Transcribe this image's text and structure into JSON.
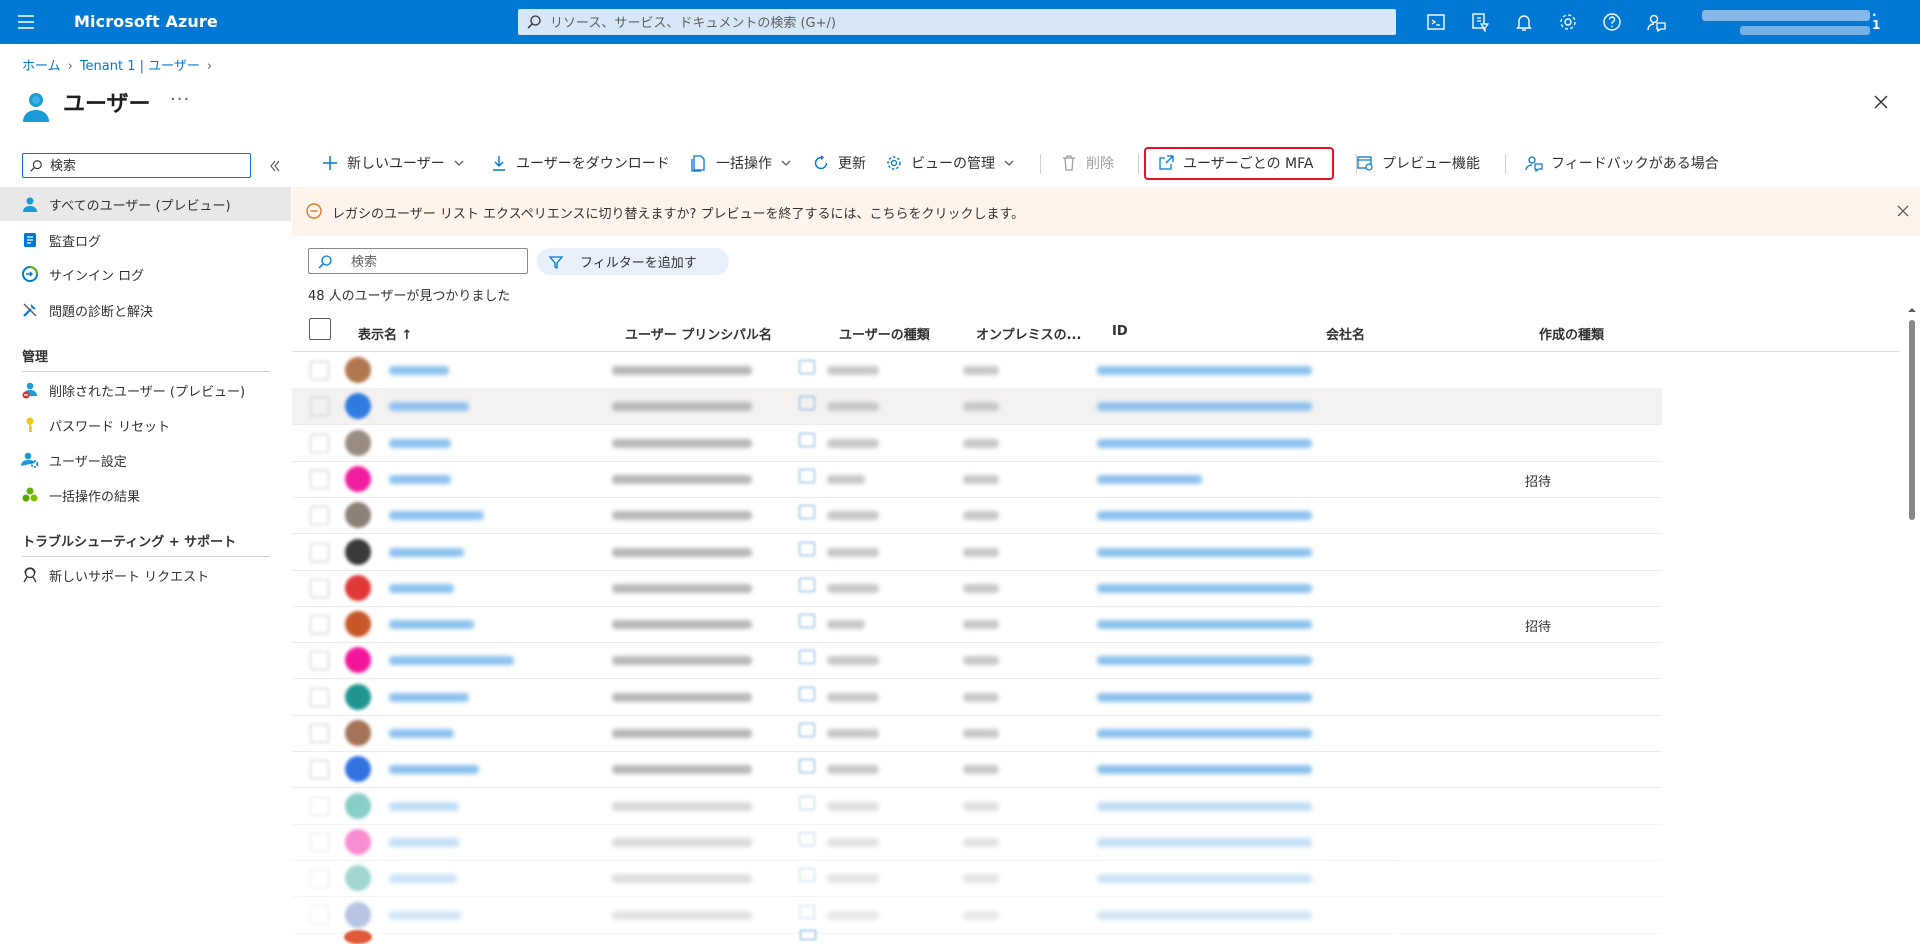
{
  "topbar": {
    "brand": "Microsoft Azure",
    "search_placeholder": "リソース、サービス、ドキュメントの検索 (G+/)",
    "account_badge": "1",
    "icons": [
      "cloud-shell-icon",
      "directory-filter-icon",
      "notifications-icon",
      "settings-icon",
      "help-icon",
      "feedback-icon"
    ],
    "bar_color": "#0078d4"
  },
  "breadcrumb": [
    "ホーム",
    "Tenant 1 | ユーザー"
  ],
  "page": {
    "title": "ユーザー",
    "more": "···"
  },
  "nav": {
    "search_placeholder": "検索",
    "items": [
      {
        "label": "すべてのユーザー (プレビュー)",
        "icon": "user-icon",
        "active": true
      },
      {
        "label": "監査ログ",
        "icon": "audit-log-icon"
      },
      {
        "label": "サインイン ログ",
        "icon": "signin-log-icon"
      },
      {
        "label": "問題の診断と解決",
        "icon": "wrench-icon"
      }
    ],
    "section_manage": "管理",
    "manage_items": [
      {
        "label": "削除されたユーザー (プレビュー)",
        "icon": "deleted-user-icon"
      },
      {
        "label": "パスワード リセット",
        "icon": "key-icon"
      },
      {
        "label": "ユーザー設定",
        "icon": "user-settings-icon"
      },
      {
        "label": "一括操作の結果",
        "icon": "bulk-results-icon"
      }
    ],
    "section_support": "トラブルシューティング + サポート",
    "support_items": [
      {
        "label": "新しいサポート リクエスト",
        "icon": "support-request-icon"
      }
    ]
  },
  "commands": {
    "new_user": "新しいユーザー",
    "download": "ユーザーをダウンロード",
    "bulk": "一括操作",
    "refresh": "更新",
    "manage_view": "ビューの管理",
    "delete": "削除",
    "per_user_mfa": "ユーザーごとの MFA",
    "preview_features": "プレビュー機能",
    "feedback": "フィードバックがある場合"
  },
  "banner": {
    "text": "レガシのユーザー リスト エクスペリエンスに切り替えますか? プレビューを終了するには、こちらをクリックします。"
  },
  "filter": {
    "search_placeholder": "検索",
    "add_filter": "フィルターを追加す",
    "result_count": "48 人のユーザーが見つかりました"
  },
  "table": {
    "columns": [
      "表示名 ↑",
      "ユーザー プリンシパル名",
      "ユーザーの種類",
      "オンプレミスの...",
      "ID",
      "会社名",
      "作成の種類"
    ],
    "rows": [
      {
        "creation_type": ""
      },
      {
        "creation_type": ""
      },
      {
        "creation_type": ""
      },
      {
        "creation_type": "招待"
      },
      {
        "creation_type": ""
      },
      {
        "creation_type": ""
      },
      {
        "creation_type": ""
      },
      {
        "creation_type": "招待"
      },
      {
        "creation_type": ""
      },
      {
        "creation_type": ""
      },
      {
        "creation_type": ""
      },
      {
        "creation_type": ""
      },
      {
        "creation_type": ""
      },
      {
        "creation_type": ""
      },
      {
        "creation_type": ""
      },
      {
        "creation_type": ""
      }
    ]
  },
  "colors": {
    "accent": "#0078d4",
    "highlight_border": "#e81123",
    "banner_bg": "#fff4ec",
    "banner_icon": "#d97a2a"
  }
}
